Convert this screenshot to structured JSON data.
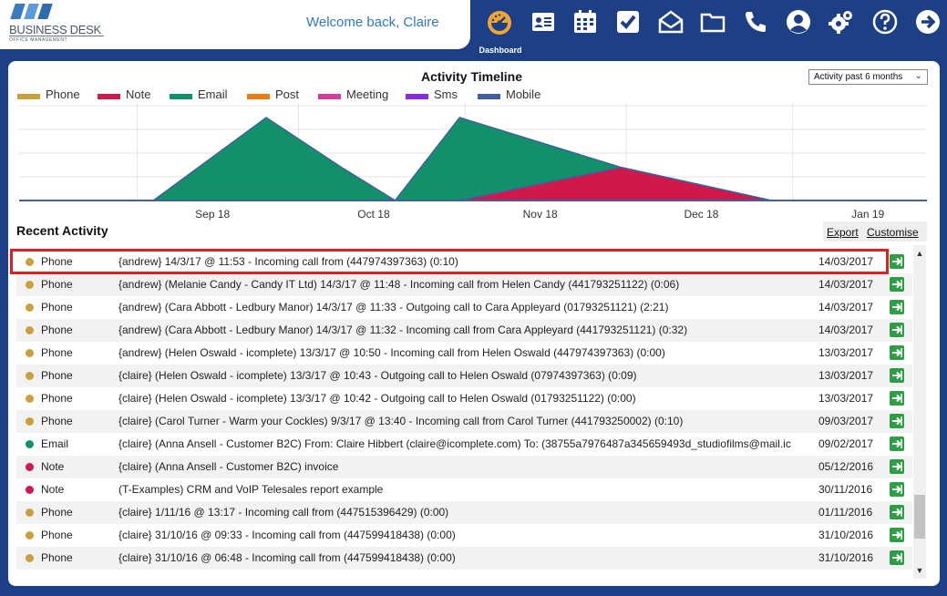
{
  "header": {
    "logo_name": "BUSINESS DESK",
    "logo_sub": "OFFICE MANAGEMENT",
    "welcome": "Welcome back, Claire",
    "active_label": "Dashboard"
  },
  "nav": [
    "dashboard",
    "contacts",
    "calendar",
    "tasks",
    "email",
    "files",
    "calls",
    "account",
    "settings",
    "help",
    "logout"
  ],
  "panel": {
    "range_value": "Activity past 6 months",
    "recent_title": "Recent Activity",
    "export_label": "Export",
    "customise_label": "Customise"
  },
  "chart_data": {
    "type": "area",
    "title": "Activity Timeline",
    "x_ticks": [
      "Sep 18",
      "Oct 18",
      "Nov 18",
      "Dec 18",
      "Jan 19"
    ],
    "legend": [
      {
        "name": "Phone",
        "color": "#c9a03a"
      },
      {
        "name": "Note",
        "color": "#d0184a"
      },
      {
        "name": "Email",
        "color": "#12906a"
      },
      {
        "name": "Post",
        "color": "#f07a12"
      },
      {
        "name": "Meeting",
        "color": "#d53ba0"
      },
      {
        "name": "Sms",
        "color": "#8a2be2"
      },
      {
        "name": "Mobile",
        "color": "#3f5fa0"
      }
    ],
    "series": [
      {
        "name": "Email",
        "color": "#12906a",
        "points": [
          [
            "2018-09-04",
            0
          ],
          [
            "2018-09-25",
            5
          ],
          [
            "2018-10-09",
            2
          ],
          [
            "2018-10-19",
            0
          ],
          [
            "2018-10-31",
            5
          ],
          [
            "2018-11-30",
            2
          ],
          [
            "2018-12-28",
            0
          ],
          [
            "2019-01-18",
            0
          ]
        ]
      },
      {
        "name": "Note",
        "color": "#d0184a",
        "points": [
          [
            "2018-09-04",
            0
          ],
          [
            "2018-10-19",
            0
          ],
          [
            "2018-10-31",
            0
          ],
          [
            "2018-11-30",
            2
          ],
          [
            "2018-12-28",
            0
          ],
          [
            "2019-01-18",
            0
          ]
        ]
      }
    ],
    "ylim": [
      0,
      5
    ]
  },
  "activities": [
    {
      "type": "Phone",
      "color": "#c9a03a",
      "desc": "{andrew} 14/3/17 @ 11:53 - Incoming call from (447974397363) (0:10)",
      "date": "14/03/2017"
    },
    {
      "type": "Phone",
      "color": "#c9a03a",
      "desc": "{andrew} (Melanie Candy - Candy IT Ltd) 14/3/17 @ 11:48 - Incoming call from Helen Candy (441793251122) (0:06)",
      "date": "14/03/2017"
    },
    {
      "type": "Phone",
      "color": "#c9a03a",
      "desc": "{andrew} (Cara Abbott - Ledbury Manor) 14/3/17 @ 11:33 - Outgoing call to Cara Appleyard (01793251121) (2:21)",
      "date": "14/03/2017"
    },
    {
      "type": "Phone",
      "color": "#c9a03a",
      "desc": "{andrew} (Cara Abbott - Ledbury Manor) 14/3/17 @ 11:32 - Incoming call from Cara Appleyard (441793251121) (0:32)",
      "date": "14/03/2017"
    },
    {
      "type": "Phone",
      "color": "#c9a03a",
      "desc": "{andrew} (Helen Oswald - icomplete) 13/3/17 @ 10:50 - Incoming call from Helen Oswald (447974397363) (0:00)",
      "date": "13/03/2017"
    },
    {
      "type": "Phone",
      "color": "#c9a03a",
      "desc": "{claire} (Helen Oswald - icomplete) 13/3/17 @ 10:43 - Outgoing call to Helen Oswald (07974397363) (0:09)",
      "date": "13/03/2017"
    },
    {
      "type": "Phone",
      "color": "#c9a03a",
      "desc": "{claire} (Helen Oswald - icomplete) 13/3/17 @ 10:42 - Outgoing call to Helen Oswald (01793251122) (0:00)",
      "date": "13/03/2017"
    },
    {
      "type": "Phone",
      "color": "#c9a03a",
      "desc": "{claire} (Carol Turner - Warm your Cockles) 9/3/17 @ 13:40 - Incoming call from Carol Turner (441793250002) (0:10)",
      "date": "09/03/2017"
    },
    {
      "type": "Email",
      "color": "#12906a",
      "desc": "{claire} (Anna Ansell - Customer B2C) From: Claire Hibbert (claire@icomplete.com) To: (38755a7976487a345659493d_studiofilms@mail.ic",
      "date": "09/02/2017"
    },
    {
      "type": "Note",
      "color": "#d0184a",
      "desc": "{claire} (Anna Ansell - Customer B2C) invoice",
      "date": "05/12/2016"
    },
    {
      "type": "Note",
      "color": "#d0184a",
      "desc": "(T-Examples) CRM and VoIP Telesales report example",
      "date": "30/11/2016"
    },
    {
      "type": "Phone",
      "color": "#c9a03a",
      "desc": "{claire} 1/11/16 @ 13:17 - Incoming call from (447515396429) (0:00)",
      "date": "01/11/2016"
    },
    {
      "type": "Phone",
      "color": "#c9a03a",
      "desc": "{claire} 31/10/16 @ 09:33 - Incoming call from (447599418438) (0:00)",
      "date": "31/10/2016"
    },
    {
      "type": "Phone",
      "color": "#c9a03a",
      "desc": "{claire} 31/10/16 @ 06:48 - Incoming call from (447599418438) (0:00)",
      "date": "31/10/2016"
    }
  ]
}
